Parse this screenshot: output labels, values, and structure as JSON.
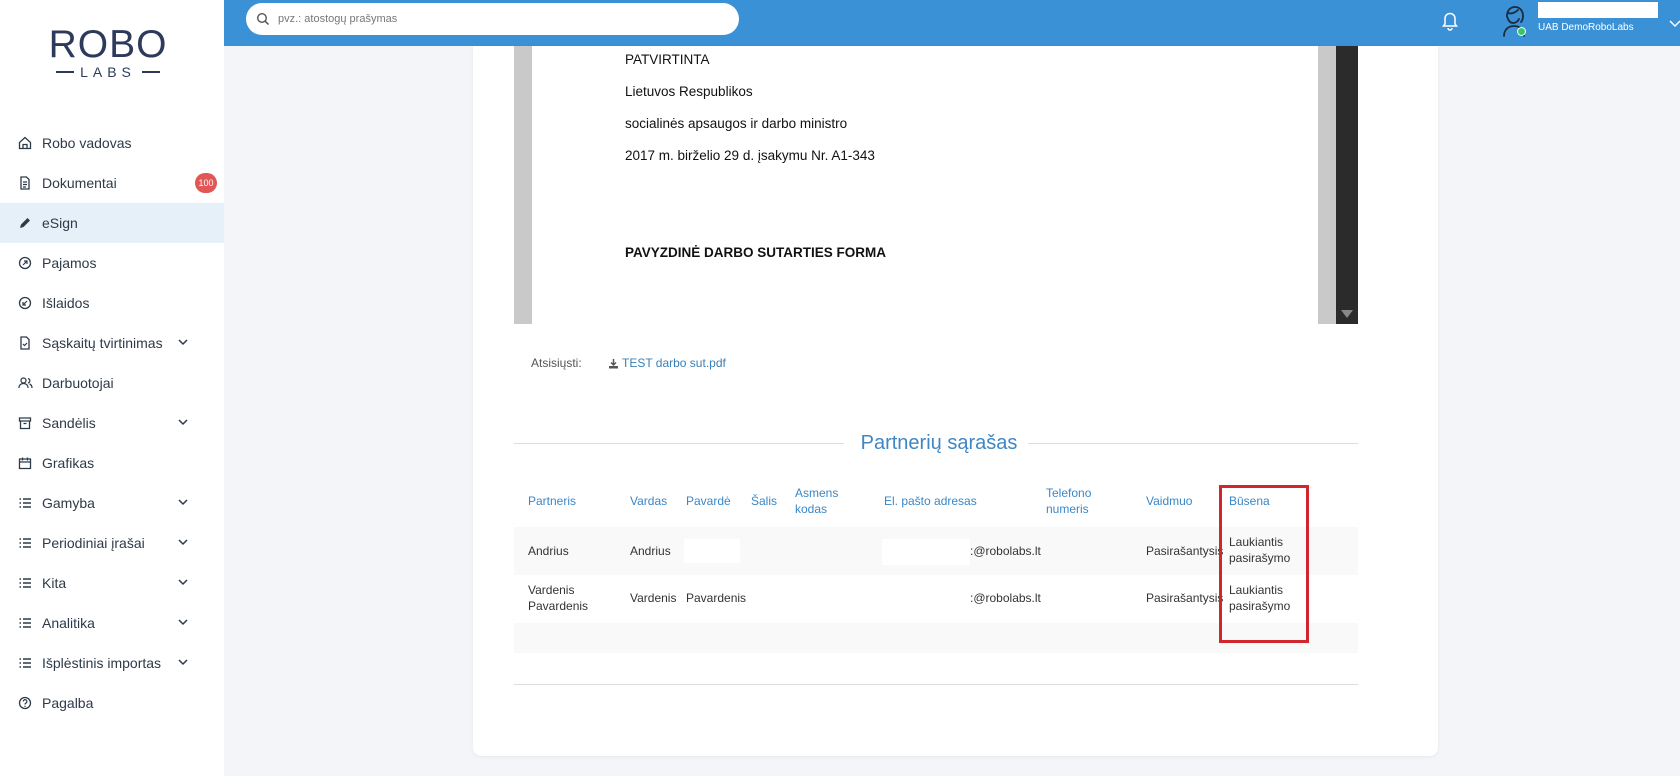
{
  "brand": {
    "logo_main": "ROBO",
    "logo_sub": "LABS"
  },
  "sidebar": {
    "items": [
      {
        "label": "Robo vadovas",
        "icon": "home-icon"
      },
      {
        "label": "Dokumentai",
        "icon": "document-icon",
        "badge": "100"
      },
      {
        "label": "eSign",
        "icon": "pen-icon",
        "active": true
      },
      {
        "label": "Pajamos",
        "icon": "income-icon"
      },
      {
        "label": "Išlaidos",
        "icon": "expense-icon"
      },
      {
        "label": "Sąskaitų tvirtinimas",
        "icon": "invoice-check-icon",
        "expandable": true
      },
      {
        "label": "Darbuotojai",
        "icon": "users-icon"
      },
      {
        "label": "Sandėlis",
        "icon": "warehouse-icon",
        "expandable": true
      },
      {
        "label": "Grafikas",
        "icon": "calendar-icon"
      },
      {
        "label": "Gamyba",
        "icon": "list-icon",
        "expandable": true
      },
      {
        "label": "Periodiniai įrašai",
        "icon": "list-icon",
        "expandable": true
      },
      {
        "label": "Kita",
        "icon": "list-icon",
        "expandable": true
      },
      {
        "label": "Analitika",
        "icon": "list-icon",
        "expandable": true
      },
      {
        "label": "Išplėstinis importas",
        "icon": "list-icon",
        "expandable": true
      },
      {
        "label": "Pagalba",
        "icon": "help-icon"
      }
    ]
  },
  "topbar": {
    "search_placeholder": "pvz.: atostogų prašymas",
    "company": "UAB DemoRoboLabs"
  },
  "document": {
    "lines": [
      "PATVIRTINTA",
      "Lietuvos Respublikos",
      "socialinės apsaugos ir darbo ministro",
      "2017 m. birželio 29 d. įsakymu Nr. A1-343"
    ],
    "heading": "PAVYZDINĖ DARBO SUTARTIES FORMA"
  },
  "download": {
    "label": "Atsisiųsti:",
    "file": "TEST darbo sut.pdf"
  },
  "partners": {
    "title": "Partnerių sąrašas",
    "columns": [
      "Partneris",
      "Vardas",
      "Pavardė",
      "Šalis",
      "Asmens kodas",
      "El. pašto adresas",
      "Telefono numeris",
      "Vaidmuo",
      "Būsena"
    ],
    "rows": [
      {
        "partner": "Andrius",
        "vardas": "Andrius",
        "pavarde": "",
        "salis": "",
        "kodas": "",
        "email": ":@robolabs.lt",
        "tel": "",
        "vaidmuo": "Pasirašantysis",
        "busena": "Laukiantis pasirašymo"
      },
      {
        "partner": "Vardenis Pavardenis",
        "vardas": "Vardenis",
        "pavarde": "Pavardenis",
        "salis": "",
        "kodas": "",
        "email": ":@robolabs.lt",
        "tel": "",
        "vaidmuo": "Pasirašantysis",
        "busena": "Laukiantis pasirašymo"
      }
    ]
  },
  "colors": {
    "topbar": "#3b91d6",
    "accent": "#3a87c7",
    "badge": "#e25656",
    "highlight": "#d0262c"
  }
}
